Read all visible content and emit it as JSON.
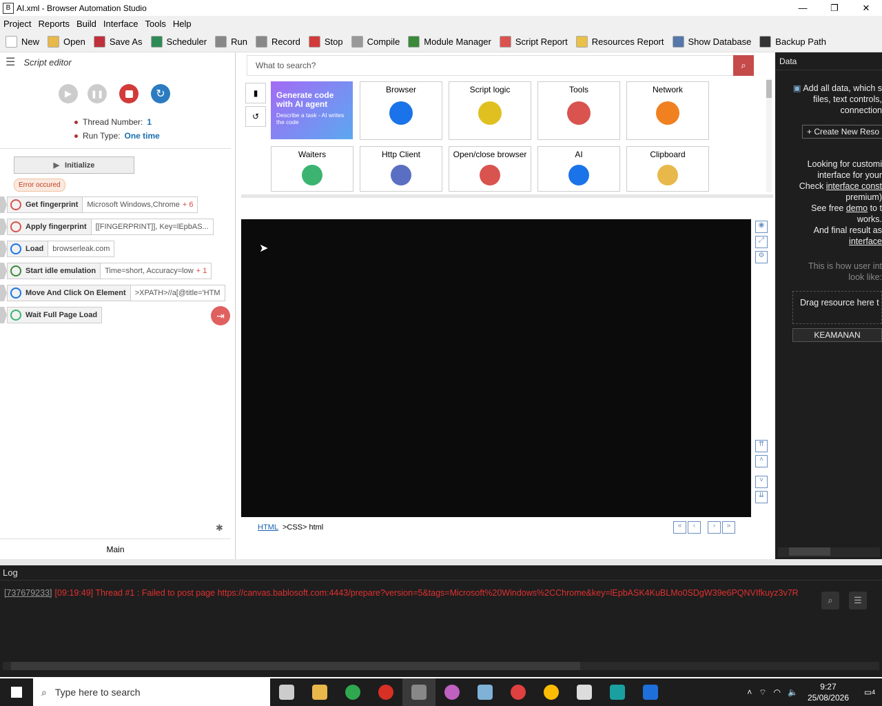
{
  "window": {
    "title": "AI.xml - Browser Automation Studio",
    "min": "—",
    "max": "❐",
    "close": "✕"
  },
  "menu": [
    "Project",
    "Reports",
    "Build",
    "Interface",
    "Tools",
    "Help"
  ],
  "toolbar": [
    {
      "label": "New",
      "icon": "new-file-icon",
      "color": "#ffffff"
    },
    {
      "label": "Open",
      "icon": "folder-icon",
      "color": "#e8b84a"
    },
    {
      "label": "Save As",
      "icon": "save-icon",
      "color": "#c0303a"
    },
    {
      "label": "Scheduler",
      "icon": "calendar-icon",
      "color": "#2e8b57"
    },
    {
      "label": "Run",
      "icon": "play-icon",
      "color": "#888888"
    },
    {
      "label": "Record",
      "icon": "record-icon",
      "color": "#888888"
    },
    {
      "label": "Stop",
      "icon": "stop-icon",
      "color": "#d33b3b"
    },
    {
      "label": "Compile",
      "icon": "box-icon",
      "color": "#999999"
    },
    {
      "label": "Module Manager",
      "icon": "puzzle-icon",
      "color": "#3a8a3a"
    },
    {
      "label": "Script Report",
      "icon": "pie-icon",
      "color": "#d9534f"
    },
    {
      "label": "Resources Report",
      "icon": "document-icon",
      "color": "#e8c04a"
    },
    {
      "label": "Show Database",
      "icon": "database-icon",
      "color": "#5577aa"
    },
    {
      "label": "Backup Path",
      "icon": "user-icon",
      "color": "#333333"
    }
  ],
  "script_editor": {
    "title": "Script editor",
    "thread_label": "Thread Number:",
    "thread_value": "1",
    "runtype_label": "Run Type:",
    "runtype_value": "One time",
    "initialize": "Initialize",
    "error": "Error occured",
    "actions": [
      {
        "name": "Get fingerprint",
        "param": "Microsoft Windows,Chrome",
        "extra": "+ 6",
        "color": "#d9534f"
      },
      {
        "name": "Apply fingerprint",
        "param": "[[FINGERPRINT]], Key=lEpbAS...",
        "extra": "",
        "color": "#d9534f"
      },
      {
        "name": "Load",
        "param": "browserleak.com",
        "extra": "",
        "color": "#1a73e8"
      },
      {
        "name": "Start idle emulation",
        "param": "Time=short, Accuracy=low",
        "extra": "+ 1",
        "color": "#3a8a3a"
      },
      {
        "name": "Move And Click On Element",
        "param": ">XPATH>//a[@title='HTM",
        "extra": "",
        "color": "#1a73e8"
      },
      {
        "name": "Wait Full Page Load",
        "param": "",
        "extra": "",
        "color": "#3cb371"
      }
    ],
    "tab": "Main"
  },
  "center": {
    "search_placeholder": "What to search?",
    "ai_tile": {
      "title": "Generate code with AI agent",
      "sub": "Describe a task - AI writes the code"
    },
    "tiles": [
      {
        "label": "Browser",
        "color": "#1a73e8"
      },
      {
        "label": "Script logic",
        "color": "#e0c020"
      },
      {
        "label": "Tools",
        "color": "#d9534f"
      },
      {
        "label": "Network",
        "color": "#f08020"
      },
      {
        "label": "Waiters",
        "color": "#3cb371"
      },
      {
        "label": "Http Client",
        "color": "#5b6fc2"
      },
      {
        "label": "Open/close browser",
        "color": "#d9534f"
      },
      {
        "label": "AI",
        "color": "#1a73e8"
      },
      {
        "label": "Clipboard",
        "color": "#e8b84a"
      }
    ],
    "path_html": "HTML",
    "path_rest": ">CSS> html"
  },
  "data_panel": {
    "title": "Data",
    "text1": "Add all data, which s files, text controls, connection",
    "create_btn": "+ Create New Reso",
    "text2": "Looking for customi interface for your",
    "check": "Check",
    "check_link": "interface const",
    "premium": "premium)",
    "see": "See free",
    "demo_link": "demo",
    "to_t": "to t",
    "works": "works.",
    "final": "And final result as",
    "interface_link": "interface",
    "user_int": "This is how user int look like:",
    "drag": "Drag resource here t create a new tab",
    "keamanan": "KEAMANAN"
  },
  "log": {
    "title": "Log",
    "id": "[737679233]",
    "message": "[09:19:49] Thread #1 : Failed to post page https://canvas.bablosoft.com:4443/prepare?version=5&tags=Microsoft%20Windows%2CChrome&key=lEpbASK4KuBLMo0SDgW39e6PQNVIfkuyz3v7R"
  },
  "taskbar": {
    "search_placeholder": "Type here to search",
    "time": "9:27",
    "date": "25/08/2026",
    "notif": "4",
    "apps": [
      {
        "icon": "task-view-icon",
        "color": "#cccccc"
      },
      {
        "icon": "file-explorer-icon",
        "color": "#e8b84a"
      },
      {
        "icon": "chrome-icon",
        "color": "#2fa84f"
      },
      {
        "icon": "chrome-icon",
        "color": "#d93025"
      },
      {
        "icon": "bas-icon",
        "color": "#888888"
      },
      {
        "icon": "paint-icon",
        "color": "#c060c0"
      },
      {
        "icon": "notepad-icon",
        "color": "#7fb2d6"
      },
      {
        "icon": "profile-icon",
        "color": "#e04040"
      },
      {
        "icon": "chrome-icon",
        "color": "#fbbc04"
      },
      {
        "icon": "app-icon",
        "color": "#dddddd"
      },
      {
        "icon": "script-icon",
        "color": "#1aa0a0"
      },
      {
        "icon": "outlook-icon",
        "color": "#1e6fd9"
      }
    ]
  }
}
